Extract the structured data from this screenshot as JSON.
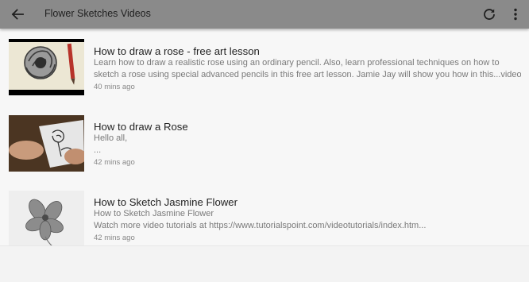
{
  "app_bar": {
    "title": "Flower Sketches Videos",
    "back_icon": "arrow-back-icon",
    "refresh_icon": "refresh-icon",
    "menu_icon": "more-vert-icon",
    "background": "#8a8a8a"
  },
  "videos": [
    {
      "title": "How to draw a rose - free art lesson",
      "desc_line1": "Learn how to draw a realistic rose using an ordinary pencil. Also, learn professional techniques on how to",
      "desc_line2": "sketch a rose using special advanced pencils in this free art lesson. Jamie Jay will show you how in this...video",
      "time": "40 mins ago"
    },
    {
      "title": "How to draw a Rose",
      "desc_line1": "Hello all,",
      "desc_line2": "...",
      "time": "42 mins ago"
    },
    {
      "title": "How to Sketch Jasmine Flower",
      "desc_line1": "How to Sketch Jasmine Flower",
      "desc_line2": "Watch more video tutorials at https://www.tutorialspoint.com/videotutorials/index.htm...",
      "time": "42 mins ago"
    }
  ]
}
